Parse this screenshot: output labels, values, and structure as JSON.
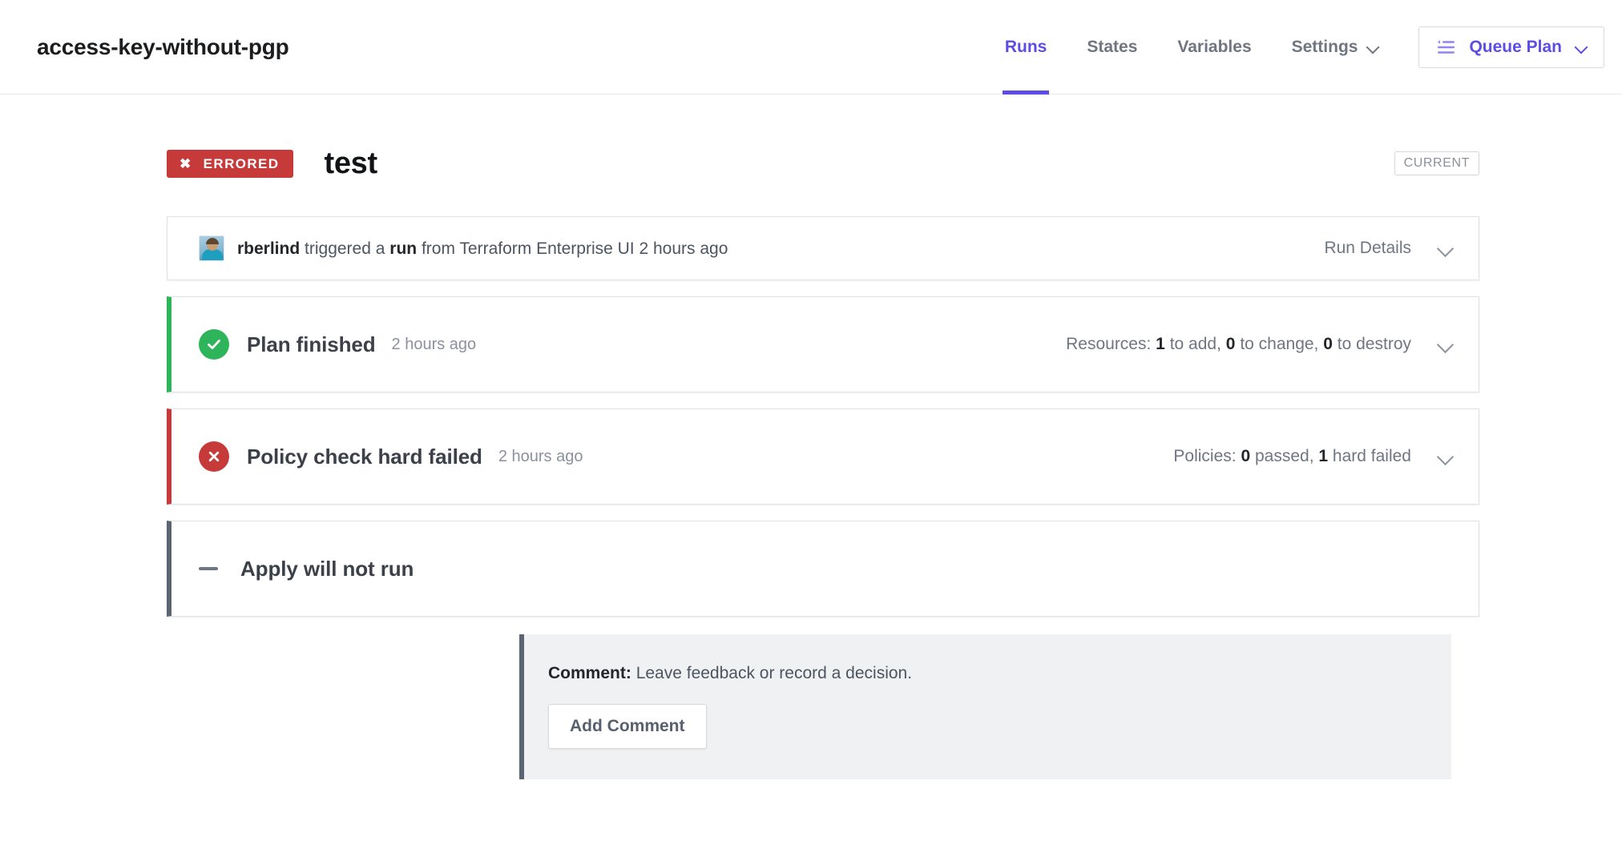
{
  "header": {
    "workspace_title": "access-key-without-pgp",
    "nav": [
      {
        "label": "Runs",
        "active": true,
        "has_chevron": false
      },
      {
        "label": "States",
        "active": false,
        "has_chevron": false
      },
      {
        "label": "Variables",
        "active": false,
        "has_chevron": false
      },
      {
        "label": "Settings",
        "active": false,
        "has_chevron": true
      }
    ],
    "queue_plan": {
      "label": "Queue Plan",
      "icon": "queue-list-icon",
      "chevron": "chevron-down-icon"
    },
    "accent_color": "#5c4ee5"
  },
  "run": {
    "status_badge": {
      "label": "ERRORED",
      "icon": "x-icon",
      "color": "#c73a3a"
    },
    "name": "test",
    "current_badge": "CURRENT"
  },
  "timeline": {
    "trigger": {
      "avatar": "user-avatar",
      "user": "rberlind",
      "text_before": "triggered a",
      "emphasis": "run",
      "text_after": "from Terraform Enterprise UI 2 hours ago",
      "details_label": "Run Details",
      "disclosure": "chevron-down-icon"
    },
    "plan": {
      "icon": "check-circle-icon",
      "icon_color": "#2eb55c",
      "title": "Plan finished",
      "time": "2 hours ago",
      "summary_prefix": "Resources:",
      "add_count": "1",
      "add_label": "to add,",
      "change_count": "0",
      "change_label": "to change,",
      "destroy_count": "0",
      "destroy_label": "to destroy",
      "disclosure": "chevron-down-icon"
    },
    "policy": {
      "icon": "x-circle-icon",
      "icon_color": "#c73a3a",
      "title": "Policy check hard failed",
      "time": "2 hours ago",
      "summary_prefix": "Policies:",
      "passed_count": "0",
      "passed_label": "passed,",
      "failed_count": "1",
      "failed_label": "hard failed",
      "disclosure": "chevron-down-icon"
    },
    "apply": {
      "icon": "minus-icon",
      "title": "Apply will not run"
    }
  },
  "comment": {
    "label": "Comment:",
    "description": "Leave feedback or record a decision.",
    "button_label": "Add Comment"
  }
}
